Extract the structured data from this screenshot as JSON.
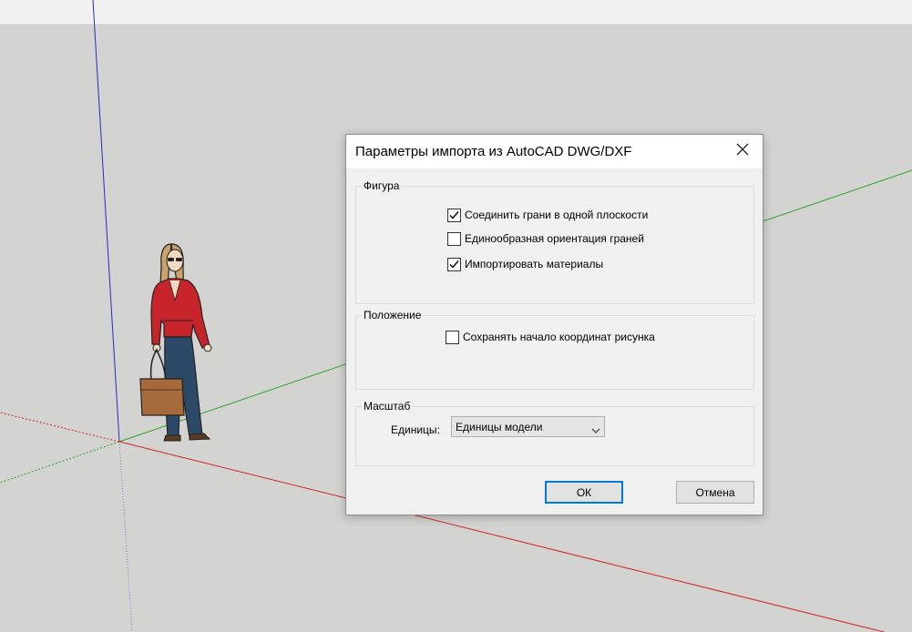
{
  "dialog": {
    "title": "Параметры импорта из AutoCAD DWG/DXF",
    "close_icon": "close-icon",
    "groups": {
      "figure": {
        "label": "Фигура",
        "options": [
          {
            "label": "Соединить грани в одной плоскости",
            "checked": true
          },
          {
            "label": "Единообразная ориентация граней",
            "checked": false
          },
          {
            "label": "Импортировать материалы",
            "checked": true
          }
        ]
      },
      "position": {
        "label": "Положение",
        "options": [
          {
            "label": "Сохранять начало координат рисунка",
            "checked": false
          }
        ]
      },
      "scale": {
        "label": "Масштаб",
        "units_label": "Единицы:",
        "units_value": "Единицы модели"
      }
    },
    "buttons": {
      "ok": "ОК",
      "cancel": "Отмена"
    }
  },
  "viewport": {
    "axis_colors": {
      "red": "#d32020",
      "green": "#22a022",
      "blue": "#2020c0"
    },
    "scale_figure": "person-figure"
  }
}
